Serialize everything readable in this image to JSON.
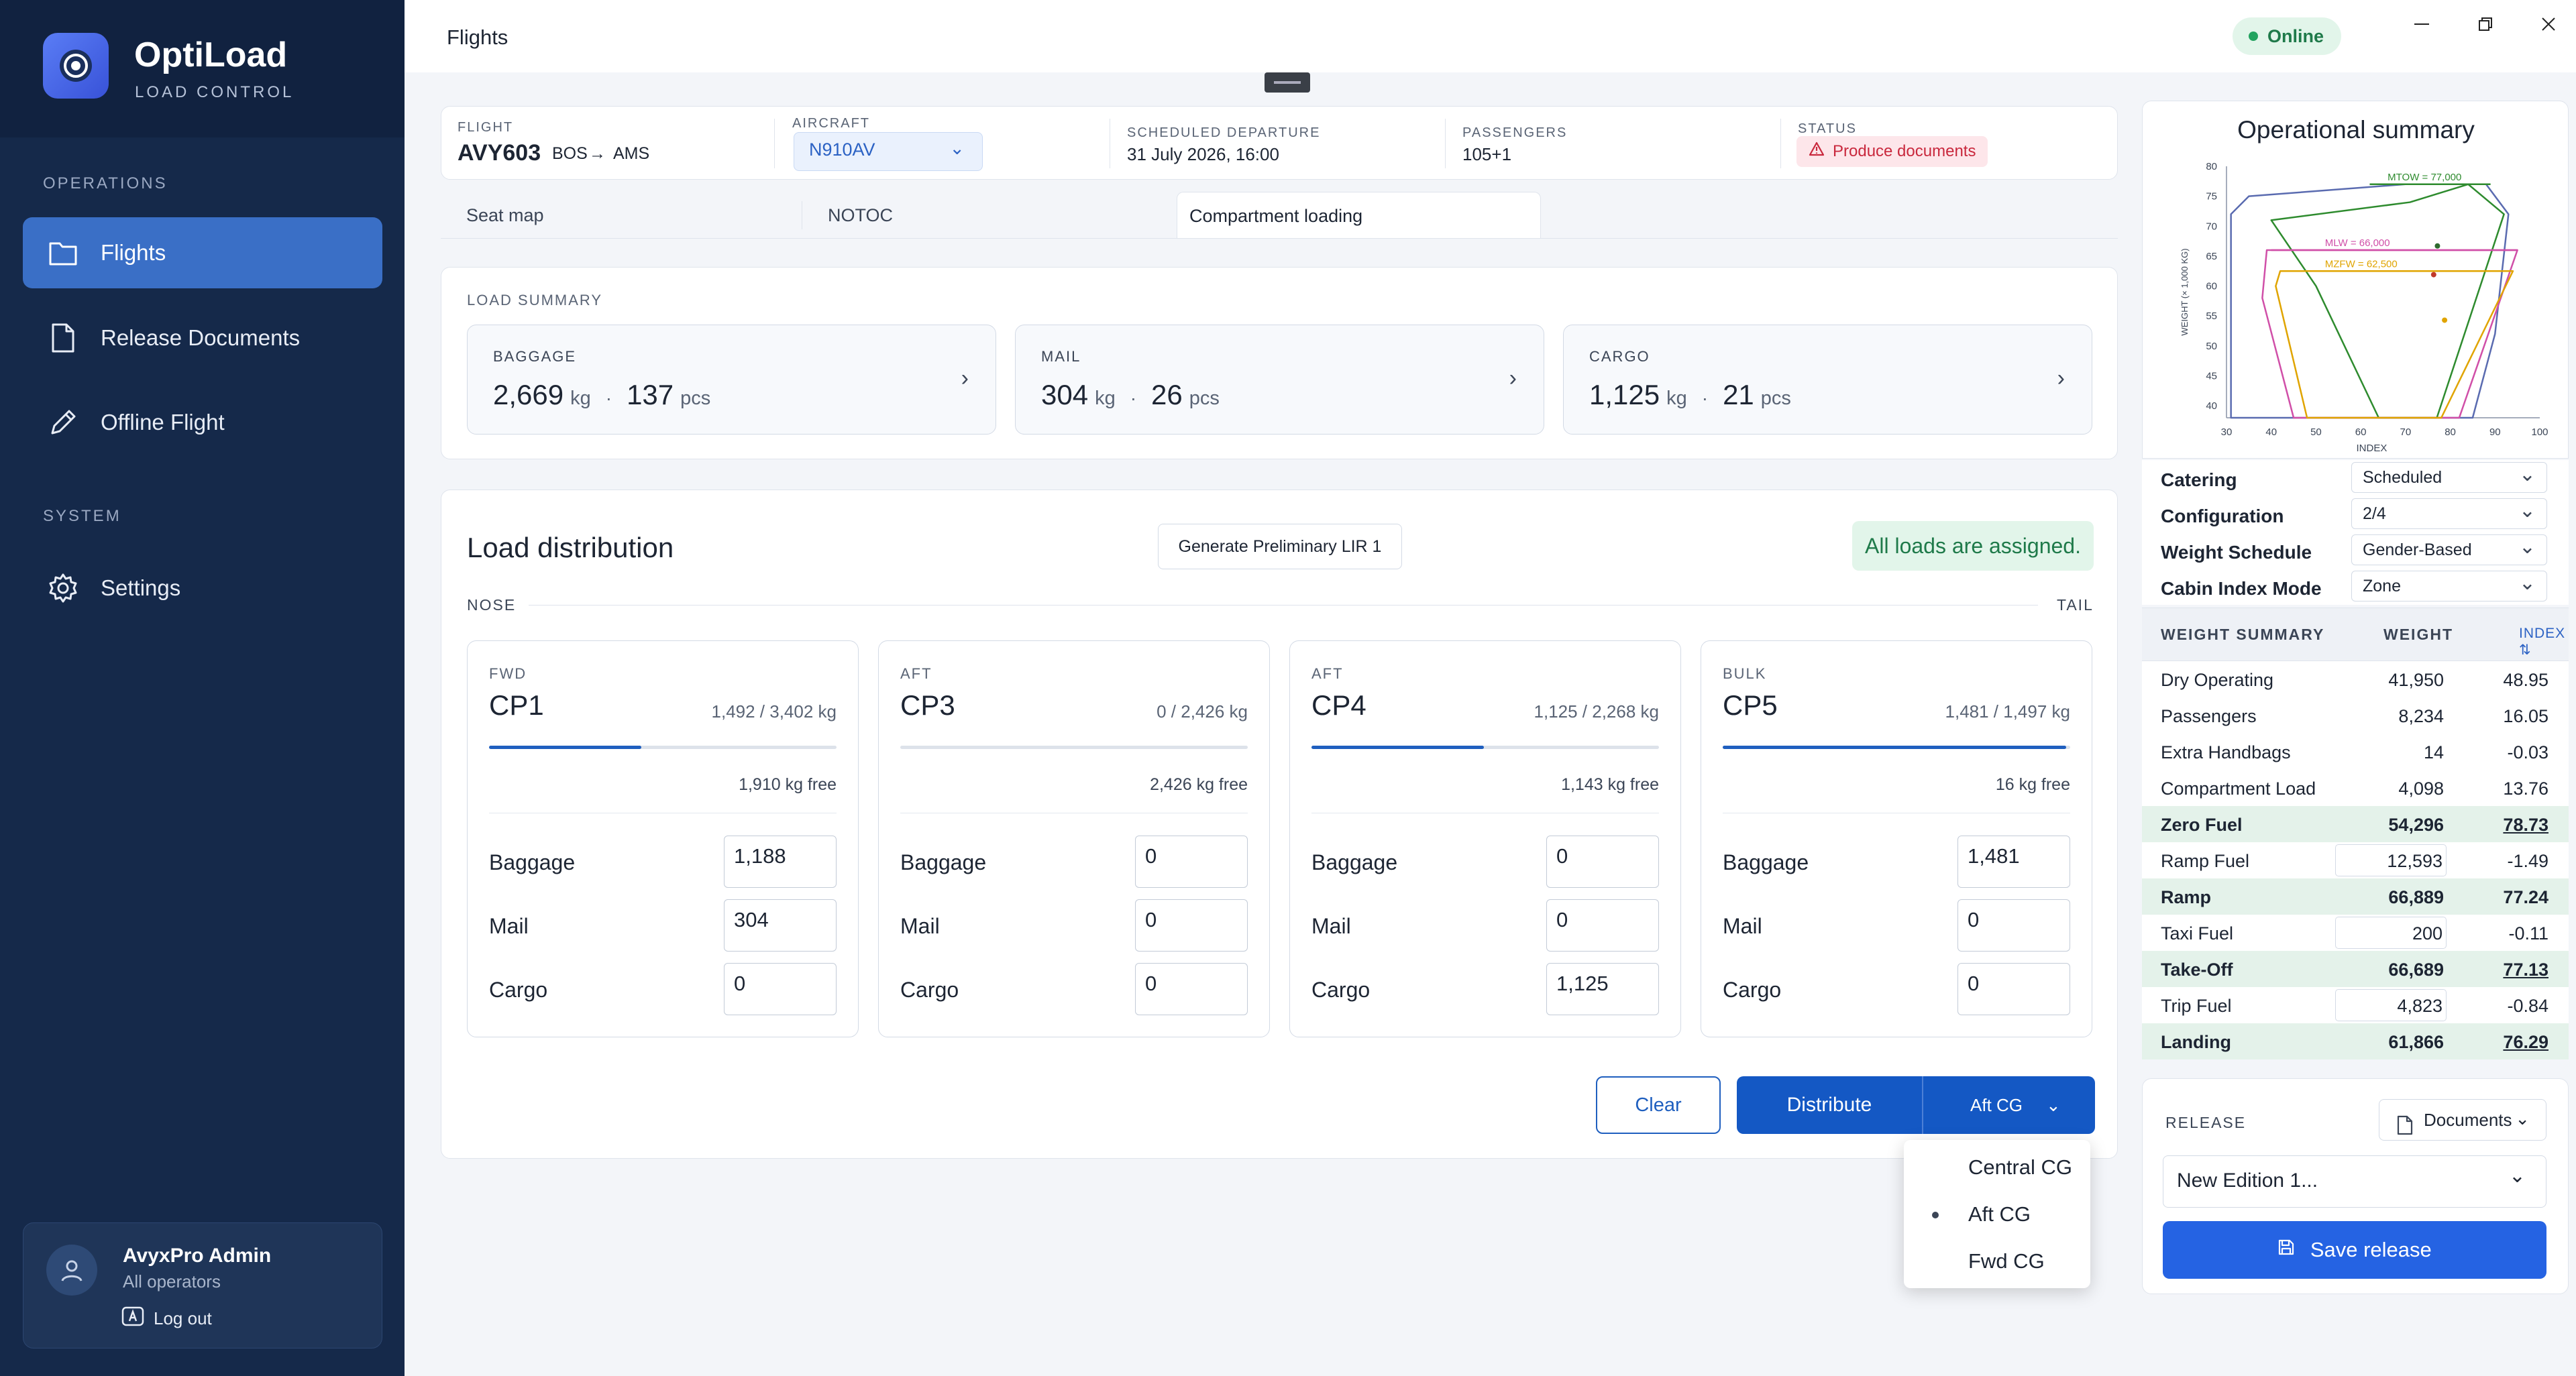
{
  "brand": {
    "name": "OptiLoad",
    "subtitle": "LOAD CONTROL"
  },
  "sidebar": {
    "sections": {
      "operations": "OPERATIONS",
      "system": "SYSTEM"
    },
    "items": [
      {
        "label": "Flights",
        "icon": "folder-icon",
        "active": true
      },
      {
        "label": "Release Documents",
        "icon": "document-icon",
        "active": false
      },
      {
        "label": "Offline Flight",
        "icon": "pencil-icon",
        "active": false
      },
      {
        "label": "Settings",
        "icon": "gear-icon",
        "active": false
      }
    ],
    "user": {
      "name": "AvyxPro Admin",
      "org": "All operators",
      "logout": "Log out"
    }
  },
  "topbar": {
    "title": "Flights",
    "status": "Online"
  },
  "flight": {
    "labels": {
      "flight": "FLIGHT",
      "aircraft": "AIRCRAFT",
      "departure": "SCHEDULED DEPARTURE",
      "passengers": "PASSENGERS",
      "status": "STATUS"
    },
    "number": "AVY603",
    "origin": "BOS",
    "destination": "AMS",
    "aircraft": "N910AV",
    "departure": "31 July 2026, 16:00",
    "passengers": "105+1",
    "status": "Produce documents"
  },
  "tabs": [
    {
      "label": "Seat map",
      "active": false
    },
    {
      "label": "NOTOC",
      "active": false
    },
    {
      "label": "Compartment loading",
      "active": true
    }
  ],
  "load_summary": {
    "title": "LOAD SUMMARY",
    "cards": [
      {
        "label": "BAGGAGE",
        "kg": "2,669",
        "kg_unit": "kg",
        "pcs": "137",
        "pcs_unit": "pcs"
      },
      {
        "label": "MAIL",
        "kg": "304",
        "kg_unit": "kg",
        "pcs": "26",
        "pcs_unit": "pcs"
      },
      {
        "label": "CARGO",
        "kg": "1,125",
        "kg_unit": "kg",
        "pcs": "21",
        "pcs_unit": "pcs"
      }
    ]
  },
  "load_distribution": {
    "title": "Load distribution",
    "generate_button": "Generate Preliminary LIR 1",
    "assigned_message": "All loads are assigned.",
    "nose": "NOSE",
    "tail": "TAIL",
    "row_labels": {
      "baggage": "Baggage",
      "mail": "Mail",
      "cargo": "Cargo"
    },
    "compartments": [
      {
        "position": "FWD",
        "name": "CP1",
        "capacity": "1,492 / 3,402 kg",
        "fill_fraction": 0.4386,
        "free": "1,910 kg free",
        "baggage": "1,188",
        "mail": "304",
        "cargo": "0"
      },
      {
        "position": "AFT",
        "name": "CP3",
        "capacity": "0 / 2,426 kg",
        "fill_fraction": 0.0,
        "free": "2,426 kg free",
        "baggage": "0",
        "mail": "0",
        "cargo": "0"
      },
      {
        "position": "AFT",
        "name": "CP4",
        "capacity": "1,125 / 2,268 kg",
        "fill_fraction": 0.496,
        "free": "1,143 kg free",
        "baggage": "0",
        "mail": "0",
        "cargo": "1,125"
      },
      {
        "position": "BULK",
        "name": "CP5",
        "capacity": "1,481 / 1,497 kg",
        "fill_fraction": 0.9893,
        "free": "16 kg free",
        "baggage": "1,481",
        "mail": "0",
        "cargo": "0"
      }
    ],
    "clear_button": "Clear",
    "distribute_button": "Distribute",
    "cg_mode": "Aft CG",
    "cg_options": [
      {
        "label": "Central CG",
        "selected": false
      },
      {
        "label": "Aft CG",
        "selected": true
      },
      {
        "label": "Fwd CG",
        "selected": false
      }
    ]
  },
  "operational_summary": {
    "title": "Operational summary",
    "chart_data": {
      "type": "line",
      "xlabel": "INDEX",
      "ylabel": "WEIGHT (× 1,000 KG)",
      "x_ticks": [
        30,
        40,
        50,
        60,
        70,
        80,
        90,
        100
      ],
      "y_ticks": [
        40,
        45,
        50,
        55,
        60,
        65,
        70,
        75,
        80
      ],
      "xlim": [
        30,
        100
      ],
      "ylim": [
        38,
        80
      ],
      "colors": {
        "envelope": "#5a6bb0",
        "mtow": "#2e8b2e",
        "mlw": "#d04fa8",
        "mzfw": "#e0a400"
      },
      "limit_lines": [
        {
          "name": "MTOW = 77,000",
          "value": 77
        },
        {
          "name": "MLW = 66,000",
          "value": 66
        },
        {
          "name": "MZFW = 62,500",
          "value": 62.5
        }
      ],
      "envelope": [
        [
          31,
          38
        ],
        [
          31,
          72
        ],
        [
          35,
          75
        ],
        [
          70,
          77
        ],
        [
          88,
          77
        ],
        [
          93,
          72
        ],
        [
          90,
          52
        ],
        [
          85,
          38
        ]
      ],
      "takeoff_envelope": [
        [
          40,
          71
        ],
        [
          71,
          74
        ],
        [
          84,
          77
        ],
        [
          92,
          72
        ],
        [
          77,
          38
        ],
        [
          64,
          38
        ],
        [
          50,
          60
        ]
      ],
      "landing_envelope": [
        [
          39,
          66
        ],
        [
          95,
          66
        ],
        [
          82,
          38
        ],
        [
          45,
          38
        ],
        [
          38,
          58
        ]
      ],
      "zfw_envelope": [
        [
          42,
          62.5
        ],
        [
          94,
          62.5
        ],
        [
          78,
          38
        ],
        [
          48,
          38
        ],
        [
          41,
          60
        ]
      ],
      "points": [
        {
          "name": "ZFW",
          "x": 78.73,
          "y": 54.3
        },
        {
          "name": "TOW",
          "x": 77.13,
          "y": 66.7
        },
        {
          "name": "LW",
          "x": 76.29,
          "y": 61.9
        }
      ]
    },
    "config": [
      {
        "label": "Catering",
        "value": "Scheduled"
      },
      {
        "label": "Configuration",
        "value": "2/4"
      },
      {
        "label": "Weight Schedule",
        "value": "Gender-Based"
      },
      {
        "label": "Cabin Index Mode",
        "value": "Zone"
      }
    ],
    "weight_summary": {
      "title": "WEIGHT SUMMARY",
      "weight_col": "WEIGHT",
      "index_col": "INDEX ⇅",
      "rows": [
        {
          "name": "Dry Operating",
          "weight": "41,950",
          "index": "48.95",
          "highlight": false,
          "input": false,
          "underline": false
        },
        {
          "name": "Passengers",
          "weight": "8,234",
          "index": "16.05",
          "highlight": false,
          "input": false,
          "underline": false
        },
        {
          "name": "Extra Handbags",
          "weight": "14",
          "index": "-0.03",
          "highlight": false,
          "input": false,
          "underline": false
        },
        {
          "name": "Compartment Load",
          "weight": "4,098",
          "index": "13.76",
          "highlight": false,
          "input": false,
          "underline": false
        },
        {
          "name": "Zero Fuel",
          "weight": "54,296",
          "index": "78.73",
          "highlight": true,
          "input": false,
          "underline": true
        },
        {
          "name": "Ramp Fuel",
          "weight": "12,593",
          "index": "-1.49",
          "highlight": false,
          "input": true,
          "underline": false
        },
        {
          "name": "Ramp",
          "weight": "66,889",
          "index": "77.24",
          "highlight": true,
          "input": false,
          "underline": false
        },
        {
          "name": "Taxi Fuel",
          "weight": "200",
          "index": "-0.11",
          "highlight": false,
          "input": true,
          "underline": false
        },
        {
          "name": "Take-Off",
          "weight": "66,689",
          "index": "77.13",
          "highlight": true,
          "input": false,
          "underline": true
        },
        {
          "name": "Trip Fuel",
          "weight": "4,823",
          "index": "-0.84",
          "highlight": false,
          "input": true,
          "underline": false
        },
        {
          "name": "Landing",
          "weight": "61,866",
          "index": "76.29",
          "highlight": true,
          "input": false,
          "underline": true
        }
      ]
    }
  },
  "release": {
    "label": "RELEASE",
    "documents_button": "Documents",
    "edition": "New Edition 1...",
    "save_button": "Save release"
  }
}
